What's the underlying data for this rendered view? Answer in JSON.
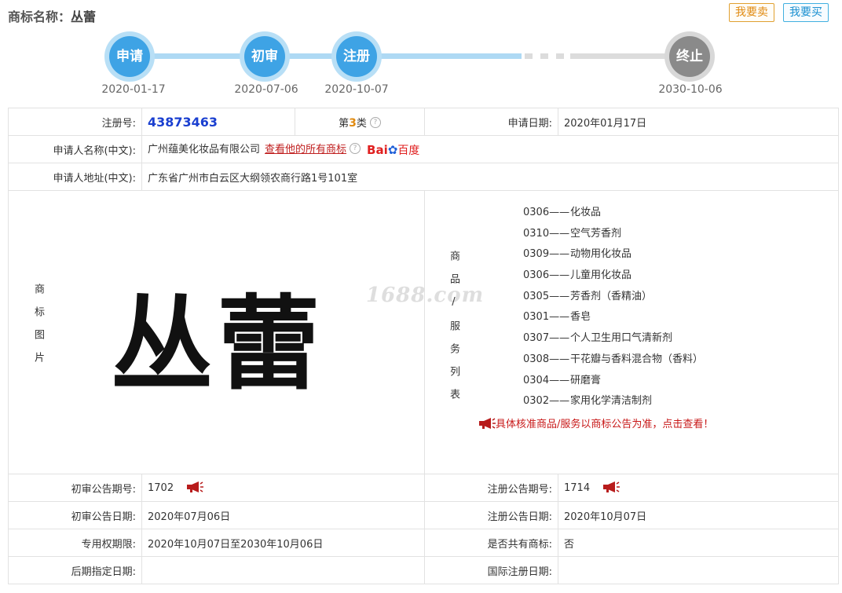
{
  "header": {
    "label": "商标名称：",
    "name": "丛蕾",
    "sell_button": "我要卖",
    "buy_button": "我要买"
  },
  "timeline": [
    {
      "label": "申请",
      "date": "2020-01-17"
    },
    {
      "label": "初审",
      "date": "2020-07-06"
    },
    {
      "label": "注册",
      "date": "2020-10-07"
    },
    {
      "label": "终止",
      "date": "2030-10-06"
    }
  ],
  "info": {
    "reg_no_label": "注册号:",
    "reg_no": "43873463",
    "class_prefix": "第",
    "class_num": "3",
    "class_suffix": "类",
    "apply_date_label": "申请日期:",
    "apply_date": "2020年01月17日",
    "applicant_label": "申请人名称(中文):",
    "applicant": "广州蕴美化妆品有限公司",
    "view_all_link": "查看他的所有商标",
    "baidu_bai": "Bai",
    "baidu_du": "百度",
    "address_label": "申请人地址(中文):",
    "address": "广东省广州市白云区大纲领农商行路1号101室",
    "mark_image_label": "商标图片",
    "mark_text": "丛蕾",
    "watermark": "1688.com",
    "goods_label": "商品/服务列表",
    "goods": [
      {
        "code": "0306——",
        "name": "化妆品"
      },
      {
        "code": "0310——",
        "name": "空气芳香剂"
      },
      {
        "code": "0309——",
        "name": "动物用化妆品"
      },
      {
        "code": "0306——",
        "name": "儿童用化妆品"
      },
      {
        "code": "0305——",
        "name": "芳香剂（香精油）"
      },
      {
        "code": "0301——",
        "name": "香皂"
      },
      {
        "code": "0307——",
        "name": "个人卫生用口气清新剂"
      },
      {
        "code": "0308——",
        "name": "干花瓣与香料混合物（香料）"
      },
      {
        "code": "0304——",
        "name": "研磨膏"
      },
      {
        "code": "0302——",
        "name": "家用化学清洁制剂"
      }
    ],
    "goods_notice": "具体核准商品/服务以商标公告为准，点击查看！",
    "prelim_no_label": "初审公告期号:",
    "prelim_no": "1702",
    "reg_pub_no_label": "注册公告期号:",
    "reg_pub_no": "1714",
    "prelim_date_label": "初审公告日期:",
    "prelim_date": "2020年07月06日",
    "reg_pub_date_label": "注册公告日期:",
    "reg_pub_date": "2020年10月07日",
    "exclusive_label": "专用权期限:",
    "exclusive": "2020年10月07日至2030年10月06日",
    "shared_label": "是否共有商标:",
    "shared": "否",
    "later_date_label": "后期指定日期:",
    "later_date": "",
    "intl_date_label": "国际注册日期:",
    "intl_date": ""
  },
  "colors": {
    "step_active": "#3ea3e5",
    "step_end": "#8a8a8a",
    "reg_no": "#1a3fd0",
    "notice": "#c81818"
  },
  "icons": [
    "help-icon",
    "megaphone-icon",
    "baidu-paw-icon"
  ]
}
